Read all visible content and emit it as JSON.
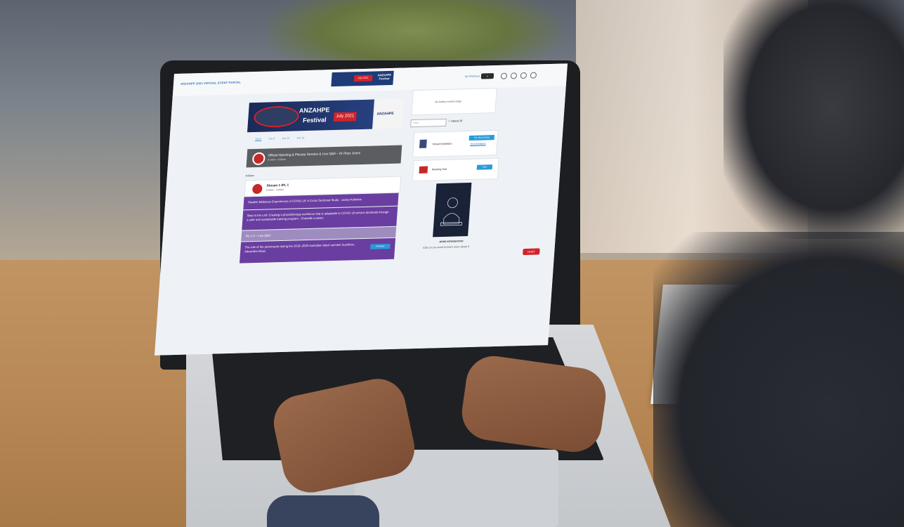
{
  "portal": {
    "title": "ANZAHPE 2021 VIRTUAL EVENT PORTAL",
    "my_profile": "MY PROFILE"
  },
  "banner": {
    "title": "ANZAHPE",
    "subtitle": "Festival",
    "date": "July 2021",
    "logo_text": "ANZAHPE"
  },
  "top_banner": {
    "date": "July 2021",
    "title": "ANZAHPE Festival"
  },
  "tabs": [
    "JUL 6",
    "JUL 8",
    "JUL 12",
    "JUL 14"
  ],
  "sessions": {
    "opening": {
      "title": "Official Opening & Plenary Session & Live Q&A – Dr Rhys Jones",
      "time": "8:10am - 9:20am"
    },
    "time_label": "8:00am",
    "stream": {
      "title": "Stream 1 IPL 1",
      "time": "8:00am - 9:00am"
    },
    "items": [
      "Student Midwives Experiences of COVID-19: A Cross Sectional Study . Lesley Kuliukas",
      "Step to the Left: Creating a physiotherapy workforce that is adaptable to COVID-19 service demands through a safe and sustainable training program . Chenelle Louwen",
      "IPL 1.4 – Live Q&A",
      "The role of the pharmacist during the 2019–2020 Australian black summer bushfires . Alexandra Moss"
    ],
    "preview_label": "Preview"
  },
  "right_panel": {
    "no_events": "No further events today",
    "filter_placeholder": "Filter",
    "attend_label": "Attend",
    "virtual_exhibition": "Virtual Exhibition",
    "my_virtual_swag": "My Virtual Swag",
    "view_exhibitors": "View Exhibitors",
    "meeting_hub": "Meeting Hub",
    "meeting_hub_btn": "View",
    "more_info": "MORE INFORMATION",
    "click_hint": "Click on an event to learn more about it",
    "chat": "CHAT"
  }
}
